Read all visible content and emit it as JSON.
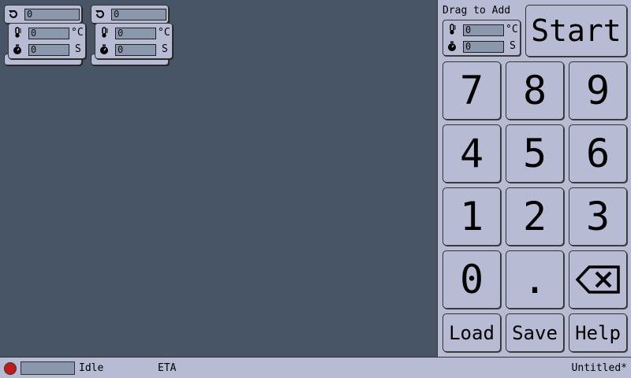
{
  "cycles": [
    {
      "cycles_value": "0",
      "temperature_value": "0",
      "temperature_unit": "°C",
      "time_value": "0",
      "time_unit": "S"
    },
    {
      "cycles_value": "0",
      "temperature_value": "0",
      "temperature_unit": "°C",
      "time_value": "0",
      "time_unit": "S"
    }
  ],
  "sidebar": {
    "drag_label": "Drag to Add",
    "template": {
      "temperature_value": "0",
      "temperature_unit": "°C",
      "time_value": "0",
      "time_unit": "S"
    },
    "start_label": "Start",
    "keypad": [
      "7",
      "8",
      "9",
      "4",
      "5",
      "6",
      "1",
      "2",
      "3",
      "0",
      "."
    ],
    "load_label": "Load",
    "save_label": "Save",
    "help_label": "Help"
  },
  "status": {
    "state": "Idle",
    "eta_label": "ETA",
    "filename": "Untitled*",
    "progress": 0
  }
}
